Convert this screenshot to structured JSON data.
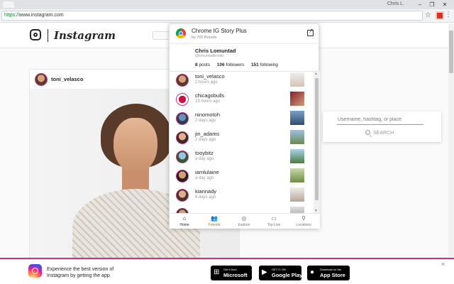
{
  "browser": {
    "user_label": "Chris L.",
    "scheme": "https://",
    "url_rest": "www.instagram.com"
  },
  "instagram": {
    "wordmark": "Instagram",
    "post_user": "toni_velasco",
    "search_placeholder": "Username, hashtag, or place",
    "search_button": "SEARCH"
  },
  "extension": {
    "title": "Chrome IG Story Plus",
    "subtitle": "by 700 Brands",
    "profile": {
      "name": "Chris Lomuntad",
      "handle": "@lomuntadbronks",
      "posts_count": "8",
      "posts_label": "posts",
      "followers_count": "106",
      "followers_label": "followers",
      "following_count": "151",
      "following_label": "following"
    },
    "stories": [
      {
        "name": "toni_velasco",
        "time": "2 hours ago"
      },
      {
        "name": "chicagobulls",
        "time": "19 hours ago"
      },
      {
        "name": "ninomotoh",
        "time": "2 days ago"
      },
      {
        "name": "jin_adams",
        "time": "2 days ago"
      },
      {
        "name": "tooybitz",
        "time": "a day ago"
      },
      {
        "name": "iamlulaine",
        "time": "a day ago"
      },
      {
        "name": "kiannady",
        "time": "6 days ago"
      },
      {
        "name": "",
        "time": ""
      }
    ],
    "nav": {
      "home": "Home",
      "friends": "Friends",
      "explore": "Explore",
      "toplive": "Top Live",
      "locations": "Locations"
    }
  },
  "banner": {
    "text": "Experience the best version of Instagram by getting the app.",
    "microsoft_small": "Get it from",
    "microsoft_big": "Microsoft",
    "google_small": "GET IT ON",
    "google_big": "Google Play",
    "apple_small": "Download on the",
    "apple_big": "App Store"
  }
}
